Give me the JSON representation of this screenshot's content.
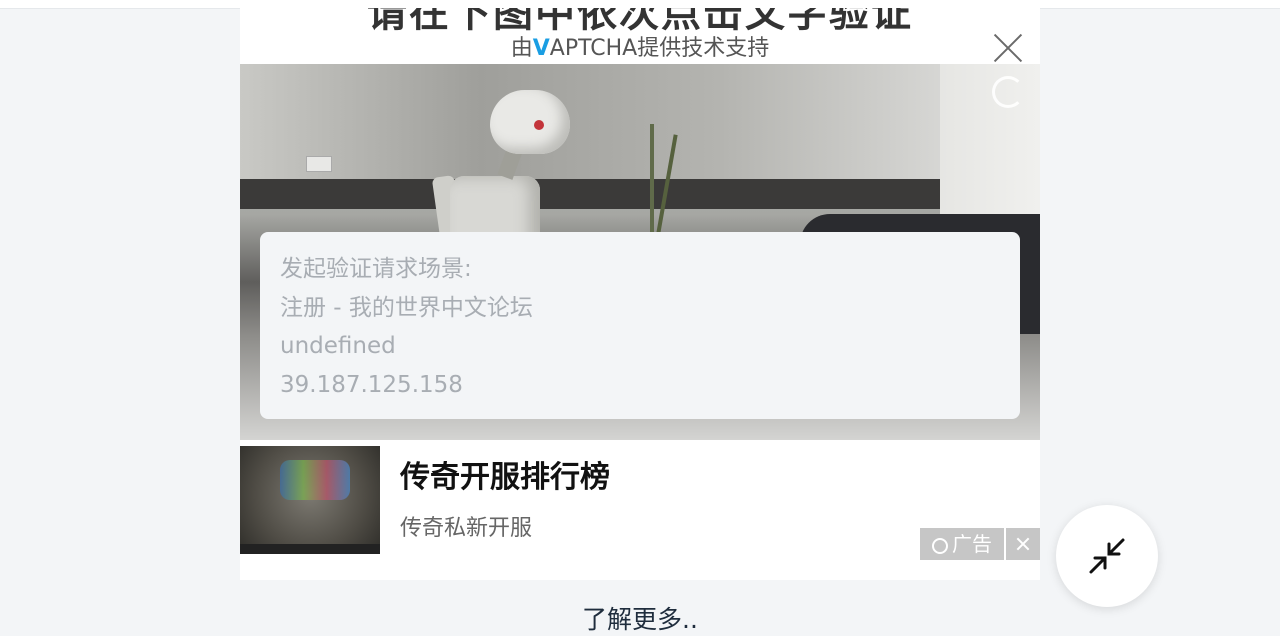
{
  "captcha": {
    "title_cut": "请在下图中依次点击文字验证",
    "powered_prefix": "由",
    "powered_brand_v": "V",
    "powered_brand_rest": "APTCHA",
    "powered_suffix": "提供技术支持",
    "close_icon": "close-icon",
    "refresh_icon": "refresh-icon"
  },
  "info": {
    "lines": [
      "发起验证请求场景:",
      "注册 - 我的世界中文论坛",
      "undefined",
      "39.187.125.158"
    ]
  },
  "ad": {
    "title": "传奇开服排行榜",
    "subtitle": "传奇私新开服",
    "badge": "广告",
    "badge_icon": "ad-icon",
    "close_icon": "close-icon"
  },
  "footer": {
    "learn_more": "了解更多.."
  },
  "fab": {
    "icon": "collapse-icon"
  },
  "colors": {
    "brand_accent": "#1a9ee3",
    "page_bg": "#f3f5f7"
  }
}
